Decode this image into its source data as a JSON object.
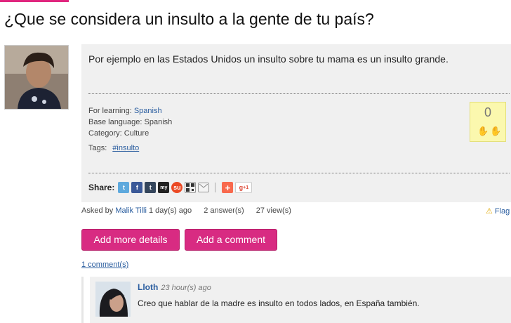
{
  "question": {
    "title": "¿Que se considera un insulto a la gente de tu país?",
    "body": "Por ejemplo en las Estados Unidos un insulto sobre tu mama es un insulto grande.",
    "for_learning_label": "For learning: ",
    "for_learning_value": "Spanish",
    "base_language": "Base language: Spanish",
    "category": "Category: Culture",
    "tags_label": "Tags:",
    "tags": [
      "#insulto"
    ],
    "vote_count": "0"
  },
  "share": {
    "label": "Share:",
    "icons": [
      "twitter-icon",
      "facebook-icon",
      "tumblr-icon",
      "myspace-icon",
      "stumbleupon-icon",
      "qr-code-icon",
      "email-icon",
      "addthis-icon",
      "google-plus-icon"
    ],
    "google_plus_text": "+1"
  },
  "asked": {
    "prefix": "Asked by ",
    "author": "Malik Tilli",
    "time": " 1 day(s) ago",
    "answers": "2 answer(s)",
    "views": "27 view(s)",
    "flag": "Flag"
  },
  "buttons": {
    "add_details": "Add more details",
    "add_comment": "Add a comment"
  },
  "comments_count": "1 comment(s)",
  "comment": {
    "author": "Lloth",
    "time": "23 hour(s) ago",
    "text": "Creo que hablar de la madre es insulto en todos lados, en España también."
  },
  "colors": {
    "accent": "#d82b82",
    "link": "#2a5d9f",
    "vote_bg": "#fbf8ae"
  }
}
